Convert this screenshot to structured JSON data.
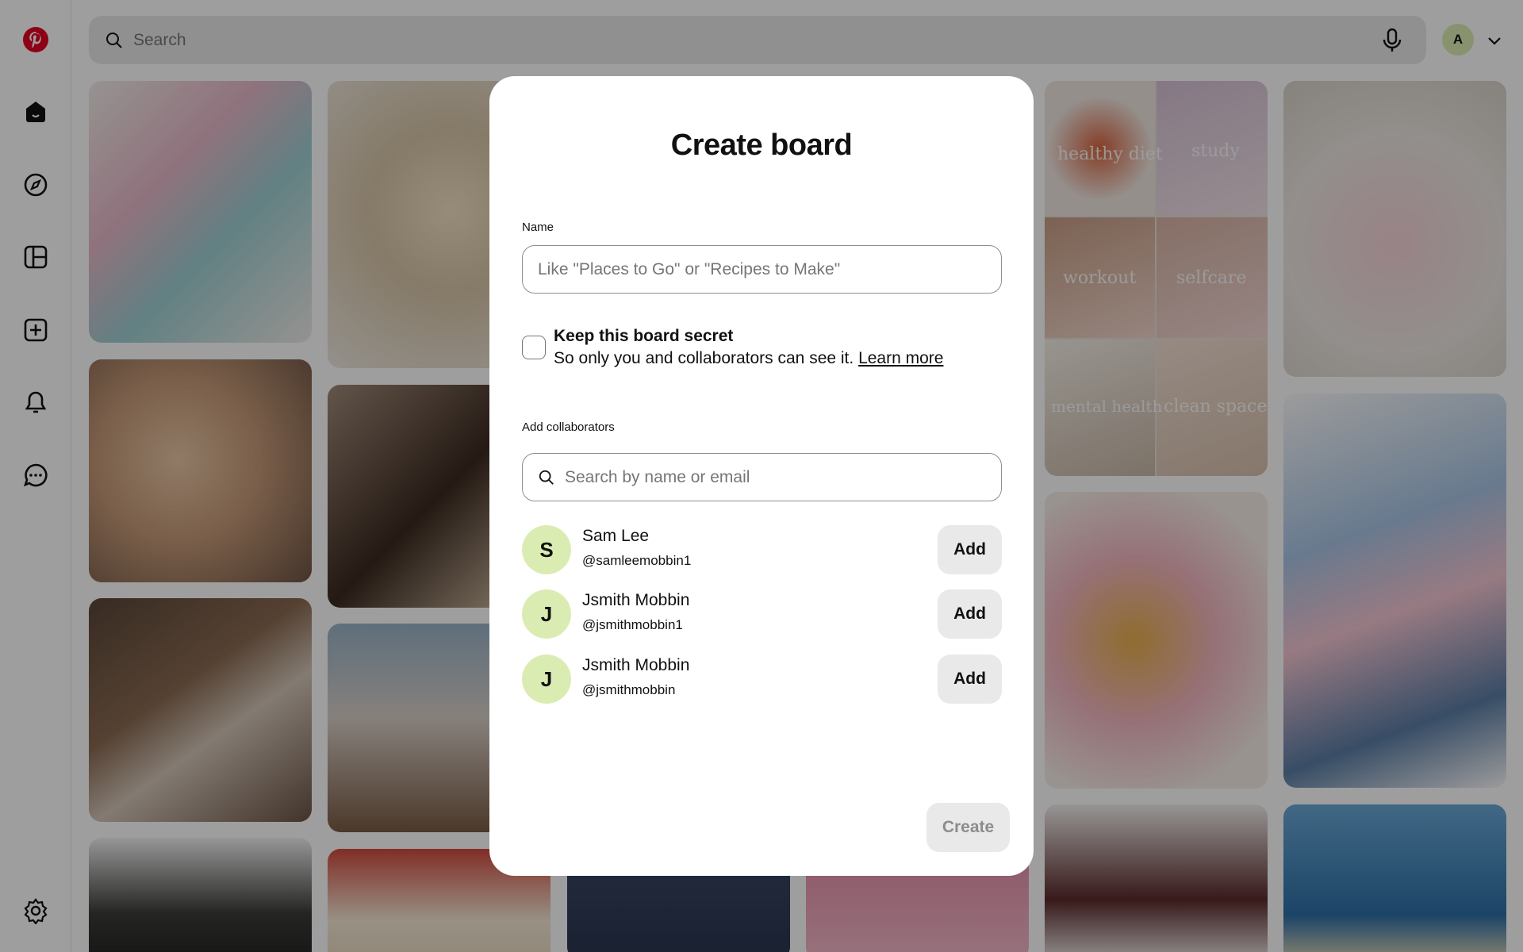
{
  "topbar": {
    "search_placeholder": "Search",
    "avatar_initial": "A"
  },
  "pins": {
    "collage_labels": [
      "healthy diet",
      "study",
      "workout",
      "selfcare",
      "mental health",
      "clean space"
    ]
  },
  "modal": {
    "title": "Create board",
    "name_label": "Name",
    "name_placeholder": "Like \"Places to Go\" or \"Recipes to Make\"",
    "secret_title": "Keep this board secret",
    "secret_desc": "So only you and collaborators can see it.",
    "learn_more": "Learn more",
    "collab_label": "Add collaborators",
    "collab_placeholder": "Search by name or email",
    "collaborators": [
      {
        "initial": "S",
        "name": "Sam Lee",
        "handle": "@samleemobbin1",
        "action": "Add"
      },
      {
        "initial": "J",
        "name": "Jsmith Mobbin",
        "handle": "@jsmithmobbin1",
        "action": "Add"
      },
      {
        "initial": "J",
        "name": "Jsmith Mobbin",
        "handle": "@jsmithmobbin",
        "action": "Add"
      }
    ],
    "create_label": "Create"
  },
  "colors": {
    "brand": "#e60023",
    "avatar_bg": "#dbecb3",
    "button_bg": "#e9e9e9"
  }
}
